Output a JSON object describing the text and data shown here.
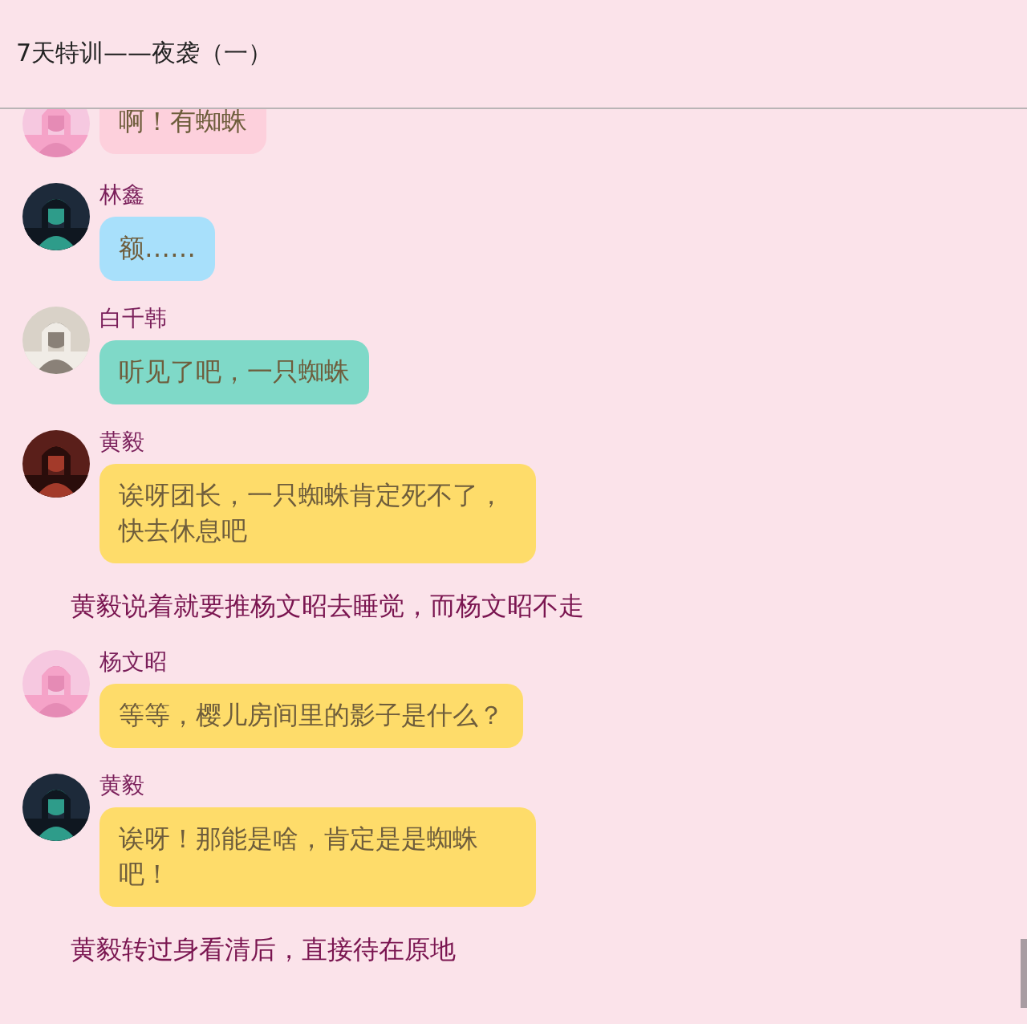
{
  "header": {
    "title": "7天特训——夜袭（一）"
  },
  "items": [
    {
      "kind": "message",
      "text": "啊！有蜘蛛",
      "color": "#fdd0dc"
    },
    {
      "kind": "message",
      "name": "林鑫",
      "text": "额……",
      "color": "#a8e0fb"
    },
    {
      "kind": "message",
      "name": "白千韩",
      "text": "听见了吧，一只蜘蛛",
      "color": "#7fd9c8"
    },
    {
      "kind": "message",
      "name": "黄毅",
      "text": "诶呀团长，一只蜘蛛肯定死不了，快去休息吧",
      "color": "#fedc6a"
    },
    {
      "kind": "narration",
      "text": "黄毅说着就要推杨文昭去睡觉，而杨文昭不走"
    },
    {
      "kind": "message",
      "name": "杨文昭",
      "text": "等等，樱儿房间里的影子是什么？",
      "color": "#fedc6a"
    },
    {
      "kind": "message",
      "name": "黄毅",
      "text": "诶呀！那能是啥，肯定是是蜘蛛吧！",
      "color": "#fedc6a"
    },
    {
      "kind": "narration",
      "text": "黄毅转过身看清后，直接待在原地"
    }
  ]
}
